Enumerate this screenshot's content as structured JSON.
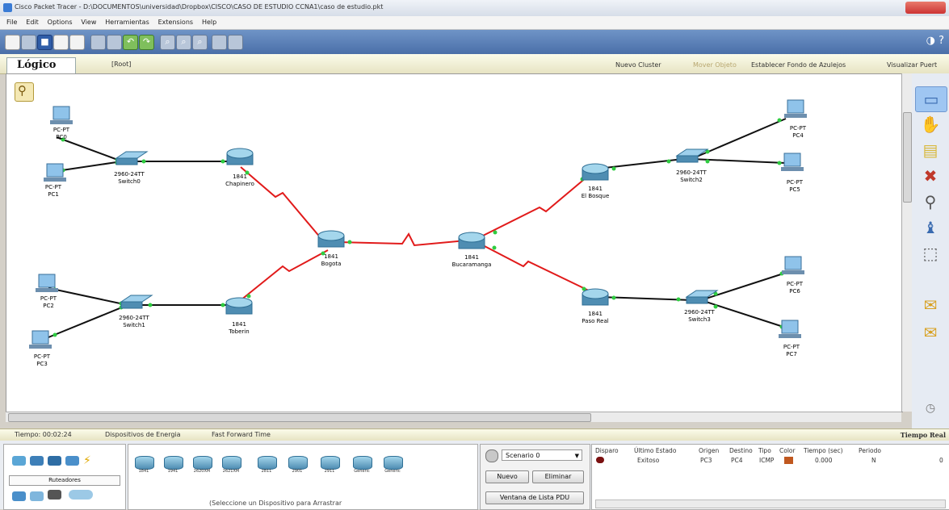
{
  "window": {
    "title": "Cisco Packet Tracer - D:\\DOCUMENTOS\\universidad\\Dropbox\\CISCO\\CASO DE ESTUDIO CCNA1\\caso de estudio.pkt"
  },
  "menu": {
    "items": [
      "File",
      "Edit",
      "Options",
      "View",
      "Herramientas",
      "Extensions",
      "Help"
    ]
  },
  "workspace": {
    "tab_label": "Lógico",
    "root_label": "[Root]",
    "nuevo_cluster": "Nuevo Cluster",
    "mover_objeto": "Mover Objeto",
    "fondo": "Establecer Fondo de Azulejos",
    "visualizar": "Visualizar Puert"
  },
  "devices": {
    "pc0": {
      "model": "PC-PT",
      "name": "PC0"
    },
    "pc1": {
      "model": "PC-PT",
      "name": "PC1"
    },
    "pc2": {
      "model": "PC-PT",
      "name": "PC2"
    },
    "pc3": {
      "model": "PC-PT",
      "name": "PC3"
    },
    "pc4": {
      "model": "PC-PT",
      "name": "PC4"
    },
    "pc5": {
      "model": "PC-PT",
      "name": "PC5"
    },
    "pc6": {
      "model": "PC-PT",
      "name": "PC6"
    },
    "pc7": {
      "model": "PC-PT",
      "name": "PC7"
    },
    "switch0": {
      "model": "2960-24TT",
      "name": "Switch0"
    },
    "switch1": {
      "model": "2960-24TT",
      "name": "Switch1"
    },
    "switch2": {
      "model": "2960-24TT",
      "name": "Switch2"
    },
    "switch3": {
      "model": "2960-24TT",
      "name": "Switch3"
    },
    "chapinero": {
      "model": "1841",
      "name": "Chapinero"
    },
    "tobirin": {
      "model": "1841",
      "name": "Toberin"
    },
    "bogota": {
      "model": "1841",
      "name": "Bogota"
    },
    "bucaramanga": {
      "model": "1841",
      "name": "Bucaramanga"
    },
    "elbosque": {
      "model": "1841",
      "name": "El Bosque"
    },
    "pasoreal": {
      "model": "1841",
      "name": "Paso Real"
    }
  },
  "status": {
    "tiempo": "Tiempo: 00:02:24",
    "ciclo": "Dispositivos de Energia",
    "ff": "Fast Forward Time",
    "mode": "Tiempo Real"
  },
  "device_panel": {
    "category_label": "Ruteadores",
    "routers": [
      "1841",
      "1941",
      "2620XM",
      "2621XM",
      "2811",
      "2901",
      "2911",
      "Generic",
      "Generic"
    ],
    "hint": "(Seleccione un Dispositivo para Arrastrar"
  },
  "scenario": {
    "selected": "Scenario 0",
    "nuevo": "Nuevo",
    "eliminar": "Eliminar",
    "ventana": "Ventana de Lista PDU"
  },
  "pdu_table": {
    "headers": [
      "Disparo",
      "Último Estado",
      "Origen",
      "Destino",
      "Tipo",
      "Color",
      "Tiempo (sec)",
      "Periodo"
    ],
    "row": {
      "estado": "Exitoso",
      "origen": "PC3",
      "destino": "PC4",
      "tipo": "ICMP",
      "tiempo": "0.000",
      "periodo": "N",
      "trailing": "0"
    }
  },
  "colors": {
    "link_serial": "#e11a1a",
    "link_ethernet": "#111111",
    "port_up": "#2ecc40"
  }
}
